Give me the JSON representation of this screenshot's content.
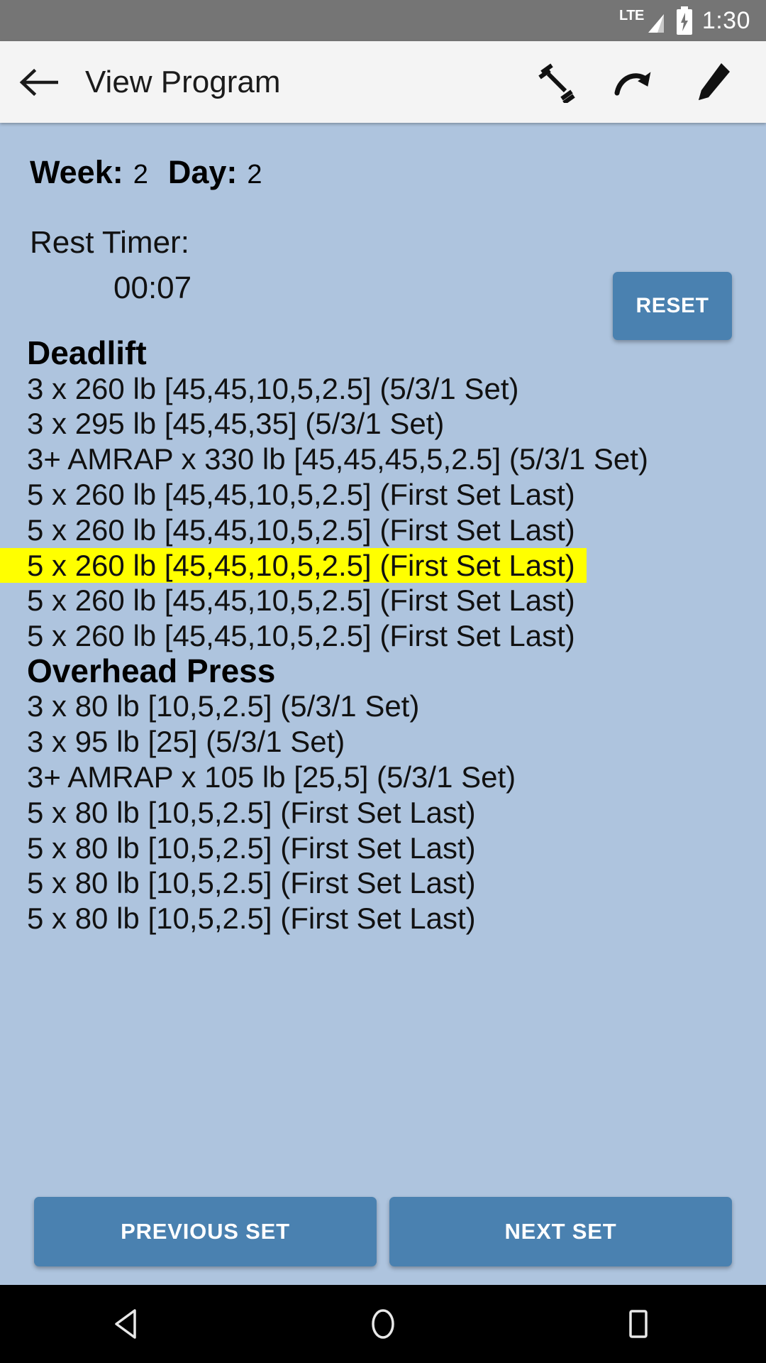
{
  "status_bar": {
    "network_label": "LTE",
    "signal_icon": "signal-bars-icon",
    "battery_icon": "battery-charging-icon",
    "time": "1:30"
  },
  "app_bar": {
    "back_icon": "back-arrow-icon",
    "title": "View Program",
    "actions": [
      {
        "name": "dumbbell-icon",
        "label": "Workout"
      },
      {
        "name": "redo-icon",
        "label": "Redo"
      },
      {
        "name": "pencil-icon",
        "label": "Edit"
      }
    ]
  },
  "program": {
    "week_label": "Week:",
    "week_value": "2",
    "day_label": "Day:",
    "day_value": "2",
    "rest_timer_label": "Rest Timer:",
    "rest_timer_value": "00:07",
    "reset_label": "RESET"
  },
  "exercises": [
    {
      "name": "Deadlift",
      "sets": [
        {
          "text": "3 x 260 lb  [45,45,10,5,2.5]  (5/3/1 Set)",
          "highlighted": false
        },
        {
          "text": "3 x 295 lb  [45,45,35]  (5/3/1 Set)",
          "highlighted": false
        },
        {
          "text": "3+ AMRAP x 330 lb  [45,45,45,5,2.5]  (5/3/1 Set)",
          "highlighted": false
        },
        {
          "text": "5 x 260 lb  [45,45,10,5,2.5]  (First Set Last)",
          "highlighted": false
        },
        {
          "text": "5 x 260 lb  [45,45,10,5,2.5]  (First Set Last)",
          "highlighted": false
        },
        {
          "text": "5 x 260 lb  [45,45,10,5,2.5]  (First Set Last)",
          "highlighted": true
        },
        {
          "text": "5 x 260 lb  [45,45,10,5,2.5]  (First Set Last)",
          "highlighted": false
        },
        {
          "text": "5 x 260 lb  [45,45,10,5,2.5]  (First Set Last)",
          "highlighted": false
        }
      ]
    },
    {
      "name": "Overhead Press",
      "sets": [
        {
          "text": "3 x 80 lb  [10,5,2.5]  (5/3/1 Set)",
          "highlighted": false
        },
        {
          "text": "3 x 95 lb  [25]  (5/3/1 Set)",
          "highlighted": false
        },
        {
          "text": "3+ AMRAP x 105 lb  [25,5]  (5/3/1 Set)",
          "highlighted": false
        },
        {
          "text": "5 x 80 lb  [10,5,2.5]  (First Set Last)",
          "highlighted": false
        },
        {
          "text": "5 x 80 lb  [10,5,2.5]  (First Set Last)",
          "highlighted": false
        },
        {
          "text": "5 x 80 lb  [10,5,2.5]  (First Set Last)",
          "highlighted": false
        },
        {
          "text": "5 x 80 lb  [10,5,2.5]  (First Set Last)",
          "highlighted": false
        }
      ]
    }
  ],
  "footer": {
    "previous_label": "PREVIOUS SET",
    "next_label": "NEXT SET"
  },
  "nav_bar": {
    "back_icon": "nav-back-triangle-icon",
    "home_icon": "nav-home-circle-icon",
    "recents_icon": "nav-recents-square-icon"
  },
  "colors": {
    "background": "#aec4de",
    "app_bar": "#f4f4f4",
    "status_bar": "#757575",
    "button": "#4a81b0",
    "highlight": "#ffff00"
  }
}
